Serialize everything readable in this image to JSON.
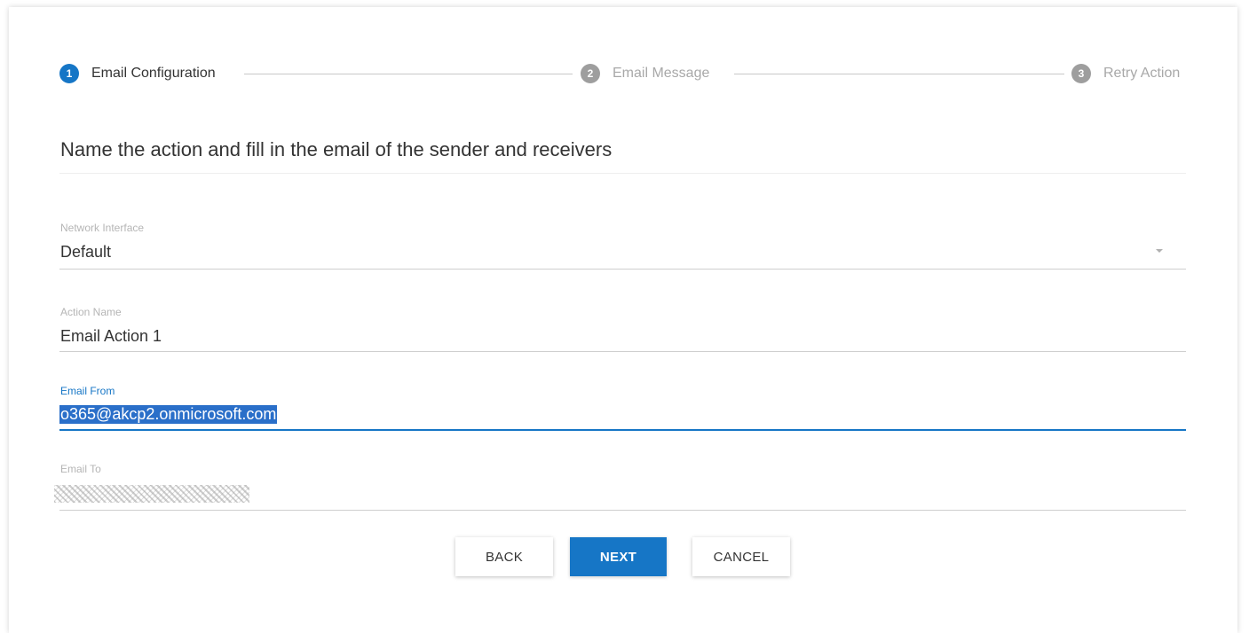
{
  "stepper": {
    "steps": [
      {
        "number": "1",
        "label": "Email Configuration",
        "state": "active"
      },
      {
        "number": "2",
        "label": "Email Message",
        "state": "inactive"
      },
      {
        "number": "3",
        "label": "Retry Action",
        "state": "inactive"
      }
    ]
  },
  "heading": "Name the action and fill in the email of the sender and receivers",
  "form": {
    "network_interface": {
      "label": "Network Interface",
      "value": "Default"
    },
    "action_name": {
      "label": "Action Name",
      "value": "Email Action 1"
    },
    "email_from": {
      "label": "Email From",
      "value": "o365@akcp2.onmicrosoft.com"
    },
    "email_to": {
      "label": "Email To"
    }
  },
  "buttons": {
    "back": "BACK",
    "next": "NEXT",
    "cancel": "CANCEL"
  },
  "colors": {
    "accent": "#1676c6",
    "inactive_step": "#9e9e9e",
    "selection": "#2a6fc9"
  }
}
